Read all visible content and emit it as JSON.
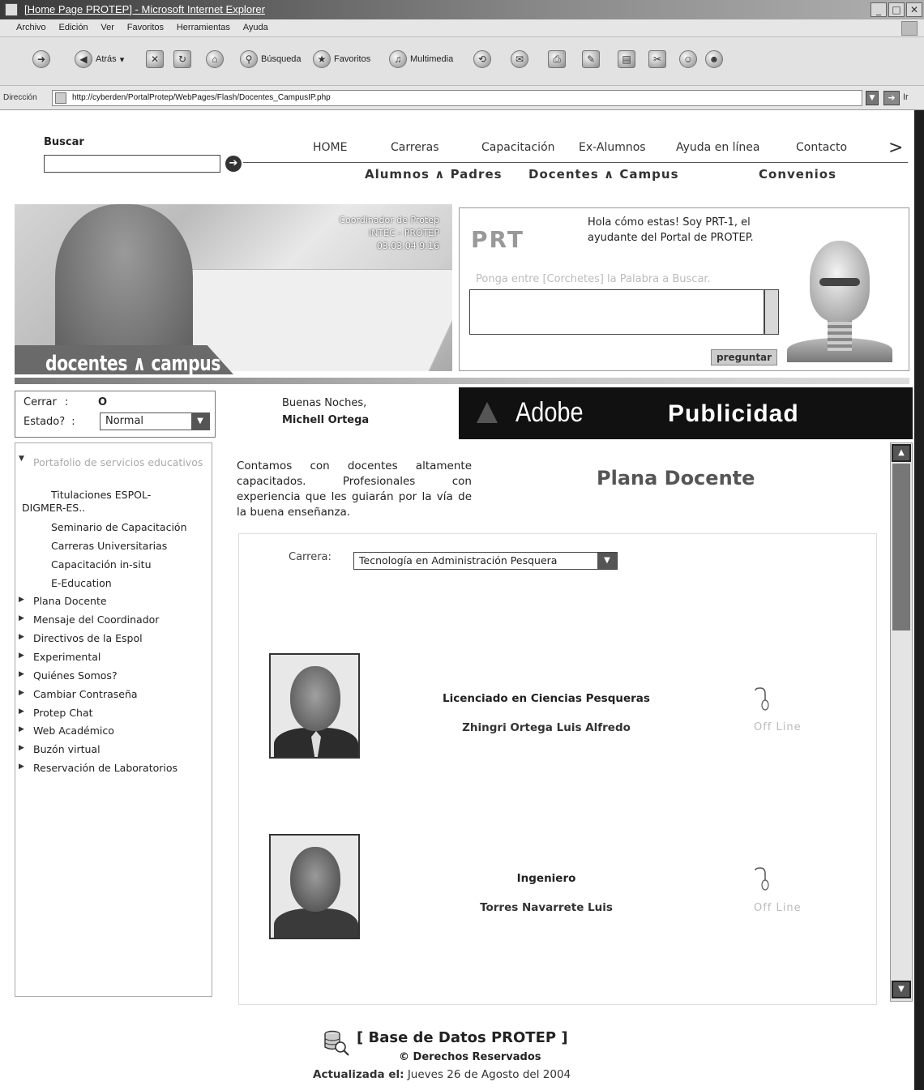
{
  "window": {
    "title": "[Home Page PROTEP] - Microsoft Internet Explorer",
    "menu": [
      "Archivo",
      "Edición",
      "Ver",
      "Favoritos",
      "Herramientas",
      "Ayuda"
    ],
    "toolbar": {
      "back": "Atrás",
      "search": "Búsqueda",
      "favorites": "Favoritos",
      "media": "Multimedia"
    },
    "address": {
      "label": "Dirección",
      "url": "http://cyberden/PortalProtep/WebPages/Flash/Docentes_CampusIP.php",
      "go": "Ir"
    }
  },
  "search": {
    "label": "Buscar",
    "value": ""
  },
  "topnav": [
    "HOME",
    "Carreras",
    "Capacitación",
    "Ex-Alumnos",
    "Ayuda en línea",
    "Contacto"
  ],
  "subnav": [
    "Alumnos ∧ Padres",
    "Docentes ∧ Campus",
    "Convenios"
  ],
  "hero": {
    "caption_line1": "Coordinador de Protep",
    "caption_line2": "INTEC - PROTEP",
    "caption_line3": "03.03.04  9:16",
    "banner": "docentes ∧ campus"
  },
  "assistant": {
    "logo": "PRT",
    "greeting": "Hola cómo estas! Soy PRT-1, el ayudante del Portal de PROTEP.",
    "hint": "Ponga entre [Corchetes] la Palabra a Buscar.",
    "ask_button": "preguntar"
  },
  "status": {
    "close_label": "Cerrar",
    "close_value": "O",
    "state_label": "Estado?",
    "state_value": "Normal"
  },
  "greeting": {
    "line": "Buenas Noches,",
    "name": "Michell Ortega"
  },
  "ad": {
    "brand": "Adobe",
    "label": "Publicidad"
  },
  "sidebar": {
    "section": "Portafolio de servicios educativos",
    "subitems": [
      "Titulaciones ESPOL-",
      "DIGMER-ES..",
      "Seminario de Capacitación",
      "Carreras Universitarias",
      "Capacitación in-situ",
      "E-Education"
    ],
    "items": [
      "Plana Docente",
      "Mensaje del Coordinador",
      "Directivos de la Espol",
      "Experimental",
      "Quiénes Somos?",
      "Cambiar Contraseña",
      "Protep Chat",
      "Web Académico",
      "Buzón virtual",
      "Reservación de Laboratorios"
    ]
  },
  "main": {
    "intro": "Contamos con docentes altamente capacitados. Profesionales con experiencia que les guiarán por la vía de la buena enseñanza.",
    "title": "Plana Docente",
    "carrera_label": "Carrera:",
    "carrera_value": "Tecnología en Administración Pesquera",
    "teachers": [
      {
        "title": "Licenciado en Ciencias Pesqueras",
        "name": "Zhingri Ortega Luis Alfredo",
        "status": "Off Line"
      },
      {
        "title": "Ingeniero",
        "name": "Torres Navarrete Luis",
        "status": "Off Line"
      }
    ]
  },
  "footer": {
    "title": "[ Base de Datos PROTEP ]",
    "copyright": "© Derechos Reservados",
    "updated_label": "Actualizada el:",
    "updated_value": "Jueves 26 de Agosto del 2004"
  }
}
